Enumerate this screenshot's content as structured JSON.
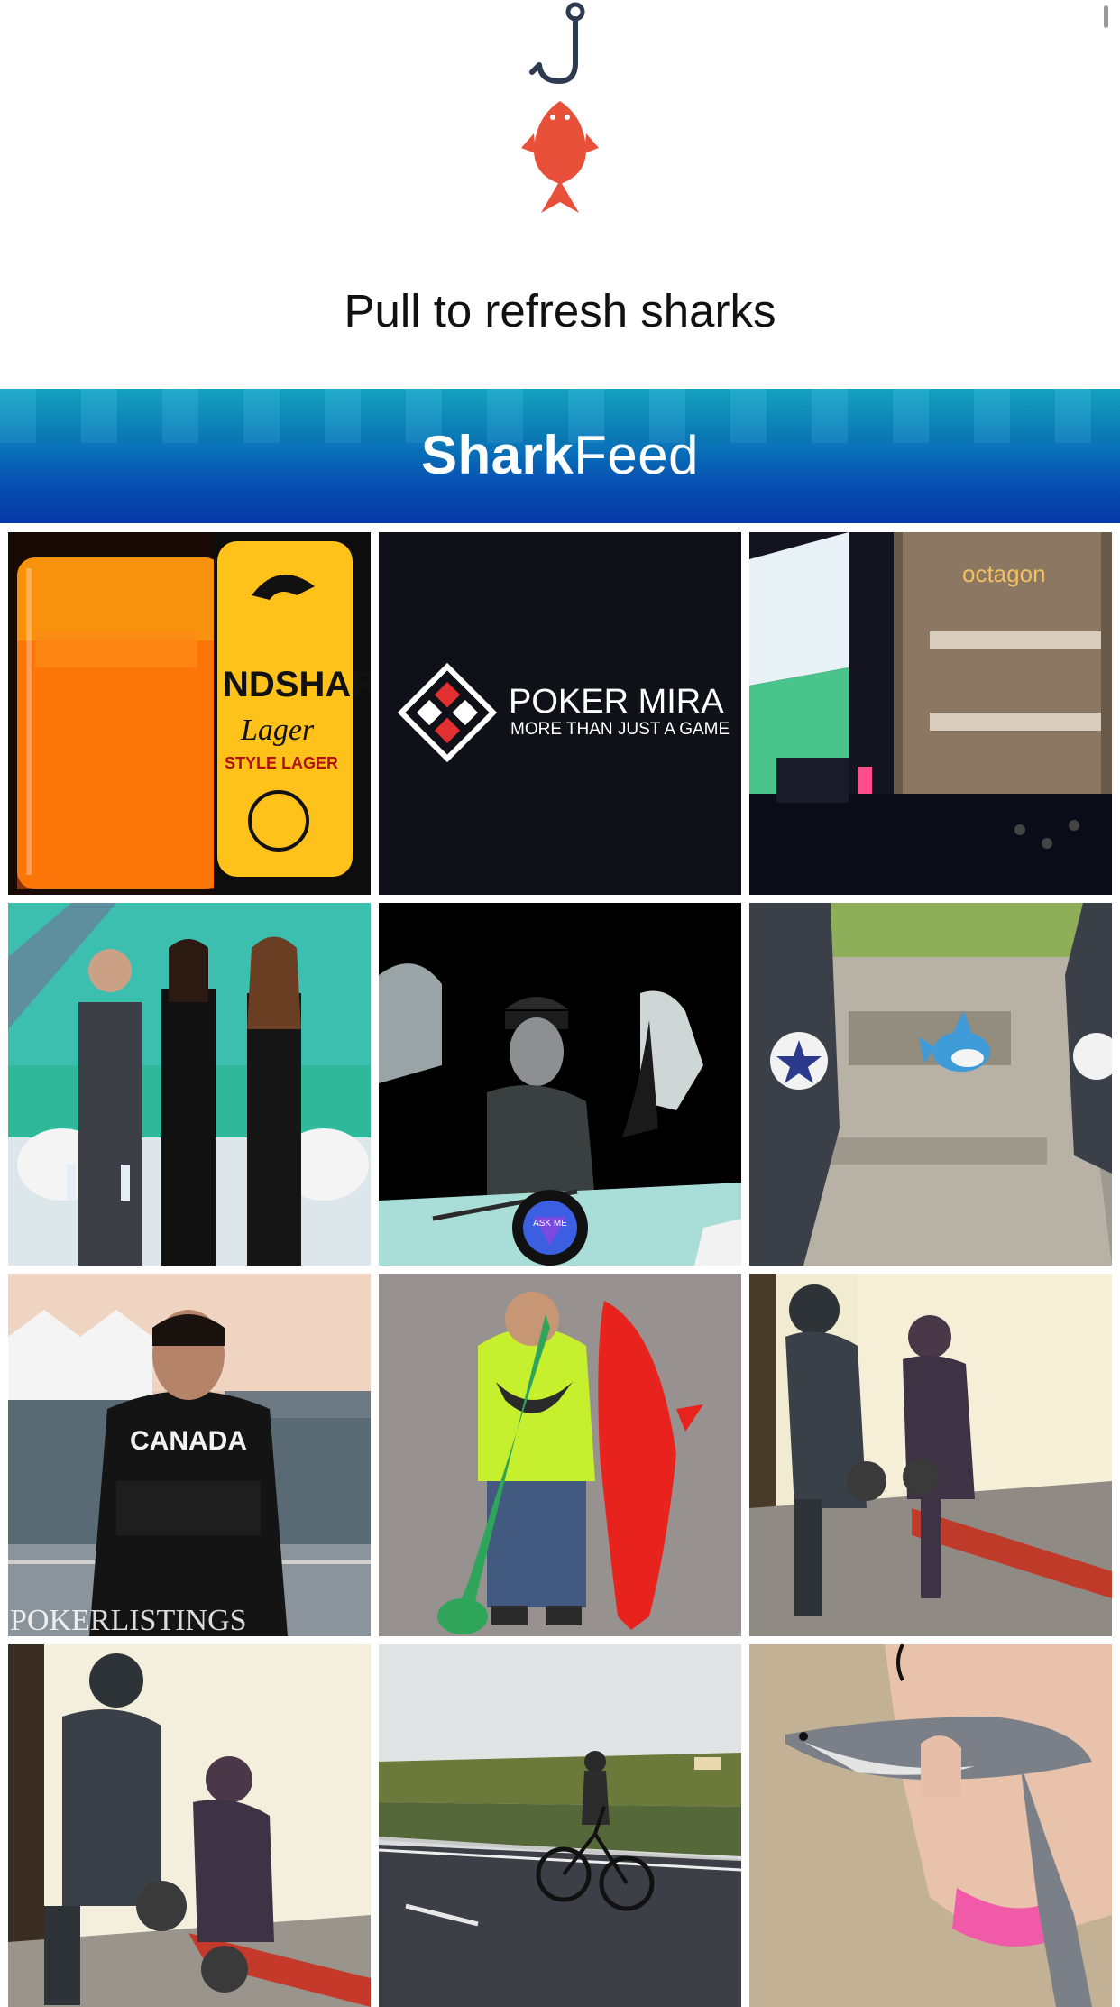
{
  "refresh": {
    "label": "Pull to refresh sharks",
    "hook_icon": "fishhook-icon",
    "fish_icon": "fish-icon",
    "fish_color": "#e8503a",
    "hook_color": "#2d3a4f"
  },
  "header": {
    "brand_bold": "Shark",
    "brand_light": "Feed"
  },
  "photos": [
    {
      "name": "photo-beer-landshark",
      "text": "NDSHARK",
      "sub": "Lager",
      "note": "STYLE LAGER"
    },
    {
      "name": "photo-poker-mira",
      "title": "POKER MIRA",
      "subtitle": "MORE THAN JUST A GAME"
    },
    {
      "name": "photo-octagon-conference",
      "text": "octagon"
    },
    {
      "name": "photo-three-people-event"
    },
    {
      "name": "photo-pool-players-poster",
      "ball": "ASK ME"
    },
    {
      "name": "photo-sneakers-plush-shark"
    },
    {
      "name": "photo-man-canada-hoodie",
      "hoodie": "CANADA",
      "watermark": "POKERLISTINGS"
    },
    {
      "name": "photo-boy-inflatable-shark"
    },
    {
      "name": "photo-painted-statues-1"
    },
    {
      "name": "photo-painted-statues-2"
    },
    {
      "name": "photo-cyclist-road"
    },
    {
      "name": "photo-child-holding-shark"
    }
  ]
}
